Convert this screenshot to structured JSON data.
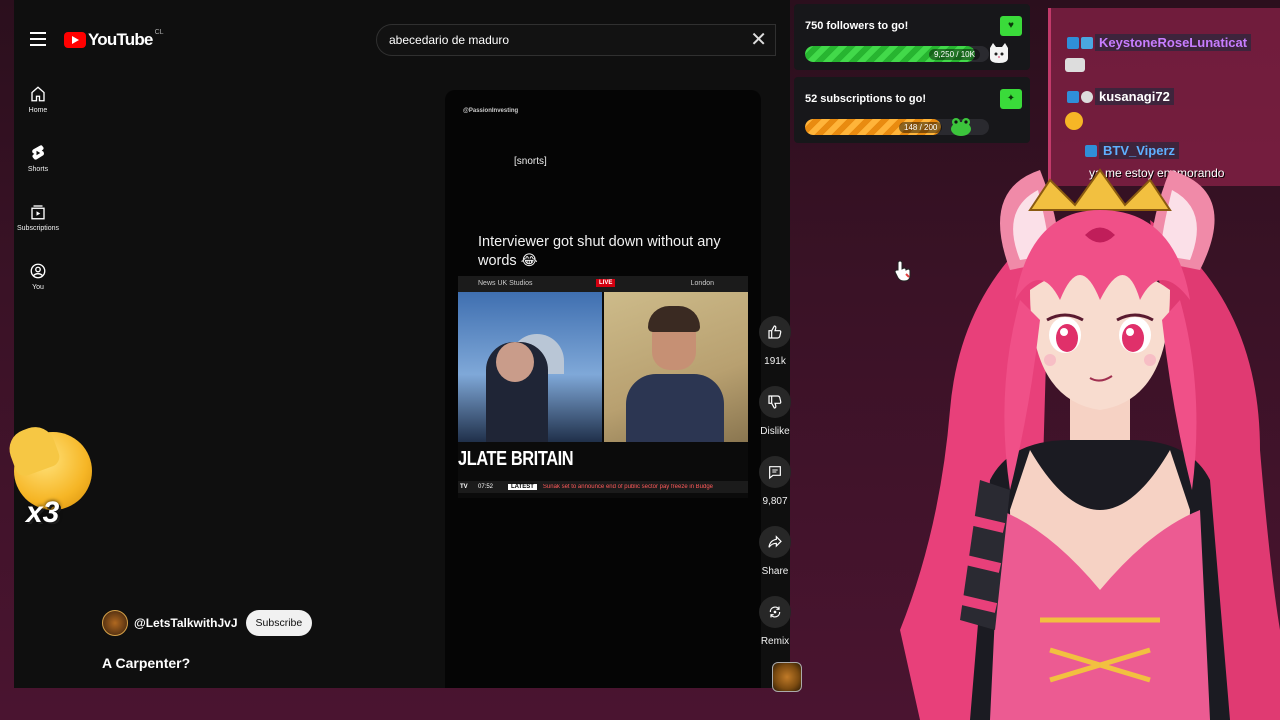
{
  "youtube": {
    "brand": "YouTube",
    "country_code": "CL",
    "search": {
      "value": "abecedario de maduro",
      "clear_label": "✕"
    },
    "guide": [
      {
        "label": "Home",
        "icon": "home-icon"
      },
      {
        "label": "Shorts",
        "icon": "shorts-icon"
      },
      {
        "label": "Subscriptions",
        "icon": "subscriptions-icon"
      },
      {
        "label": "You",
        "icon": "you-icon"
      }
    ],
    "short": {
      "watermark": "@PassionInvesting",
      "subtitle": "[snorts]",
      "caption": "Interviewer got shut down without any words 😂",
      "frame": {
        "studio": "News UK Studios",
        "live": "LIVE",
        "location": "London",
        "headline": "JLATE BRITAIN",
        "ticker_channel": "TV",
        "ticker_time": "07:52",
        "ticker_latest": "LATEST",
        "ticker_news": "Sunak set to announce end of public sector pay freeze in Budge"
      }
    },
    "actions": [
      {
        "icon": "like-icon",
        "label": "191k"
      },
      {
        "icon": "dislike-icon",
        "label": "Dislike"
      },
      {
        "icon": "comment-icon",
        "label": "9,807"
      },
      {
        "icon": "share-icon",
        "label": "Share"
      },
      {
        "icon": "remix-icon",
        "label": "Remix"
      }
    ],
    "channel": {
      "handle": "@LetsTalkwithJvJ",
      "subscribe_label": "Subscribe"
    },
    "title": "A Carpenter?"
  },
  "overlay": {
    "emoji_multiplier": "x3"
  },
  "goals": [
    {
      "title": "750 followers to go!",
      "count": "9,250 / 10K",
      "progress": 0.925,
      "color": "#42d94a",
      "icon": "heart-icon",
      "mascot": "cat-mascot"
    },
    {
      "title": "52 subscriptions to go!",
      "count": "148 / 200",
      "progress": 0.74,
      "color": "#ffb43a",
      "icon": "star-icon",
      "mascot": "frog-mascot"
    }
  ],
  "chat": [
    {
      "username": "KeystoneRoseLunaticat",
      "username_color": "#c77dff",
      "message": ""
    },
    {
      "username": "kusanagi72",
      "username_color": "#ffffff",
      "message": ""
    },
    {
      "username": "BTV_Viperz",
      "username_color": "#5fb0ff",
      "message": "ya me estoy enamorando"
    }
  ],
  "colors": {
    "youtube_bg": "#0f0f0f",
    "youtube_red": "#ff0000",
    "stream_bg": "#3a1226",
    "chat_bg": "#aa2855"
  }
}
